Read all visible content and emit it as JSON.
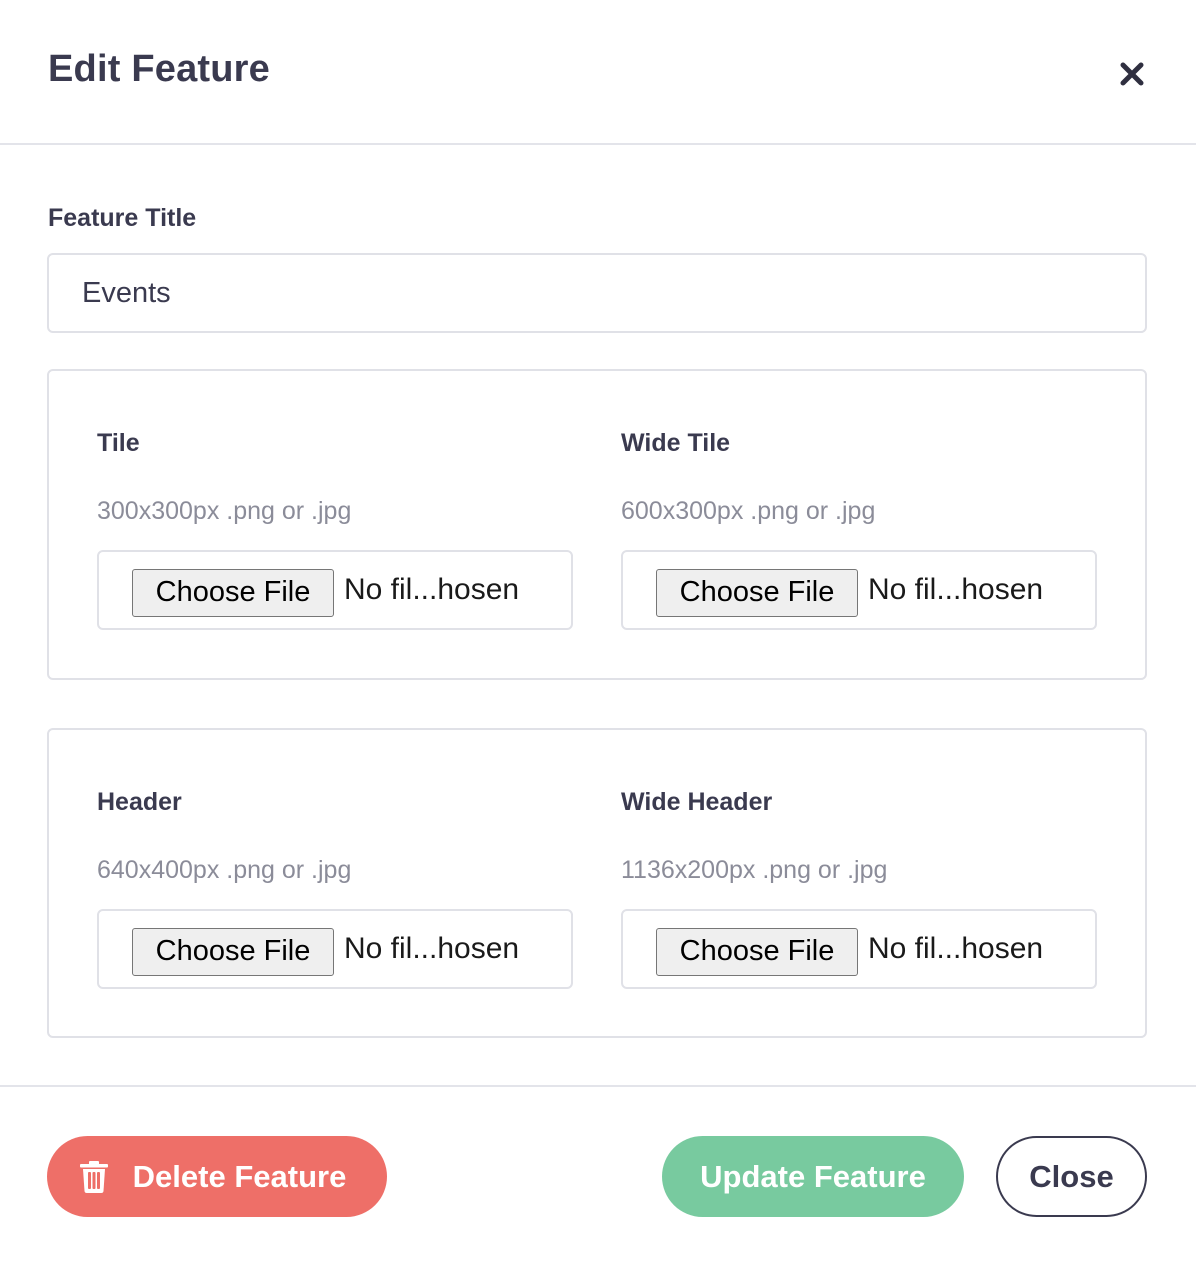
{
  "modal": {
    "title": "Edit Feature",
    "close_icon": "close-icon"
  },
  "feature_title": {
    "label": "Feature Title",
    "value": "Events"
  },
  "image_slots": [
    {
      "title": "Tile",
      "hint": "300x300px .png or .jpg",
      "choose_label": "Choose File",
      "file_status": "No fil...hosen"
    },
    {
      "title": "Wide Tile",
      "hint": "600x300px .png or .jpg",
      "choose_label": "Choose File",
      "file_status": "No fil...hosen"
    },
    {
      "title": "Header",
      "hint": "640x400px .png or .jpg",
      "choose_label": "Choose File",
      "file_status": "No fil...hosen"
    },
    {
      "title": "Wide Header",
      "hint": "1136x200px .png or .jpg",
      "choose_label": "Choose File",
      "file_status": "No fil...hosen"
    }
  ],
  "footer": {
    "delete_label": "Delete Feature",
    "delete_icon": "trash-icon",
    "update_label": "Update Feature",
    "close_label": "Close"
  },
  "colors": {
    "text": "#3a3a4f",
    "hint": "#8b8c99",
    "border": "#e0e1e7",
    "delete": "#ee6f68",
    "update": "#78ca9f"
  }
}
